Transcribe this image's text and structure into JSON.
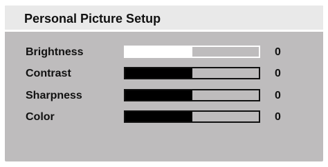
{
  "dialog": {
    "title": "Personal Picture Setup"
  },
  "settings": [
    {
      "label": "Brightness",
      "value": "0",
      "level_fraction": 0.5,
      "selected": true
    },
    {
      "label": "Contrast",
      "value": "0",
      "level_fraction": 0.5,
      "selected": false
    },
    {
      "label": "Sharpness",
      "value": "0",
      "level_fraction": 0.5,
      "selected": false
    },
    {
      "label": "Color",
      "value": "0",
      "level_fraction": 0.5,
      "selected": false
    }
  ],
  "colors": {
    "panel": "#bebcbd",
    "title_bar": "#e9e9e9",
    "selected_fill": "#ffffff",
    "fill": "#000000",
    "text": "#111111"
  }
}
